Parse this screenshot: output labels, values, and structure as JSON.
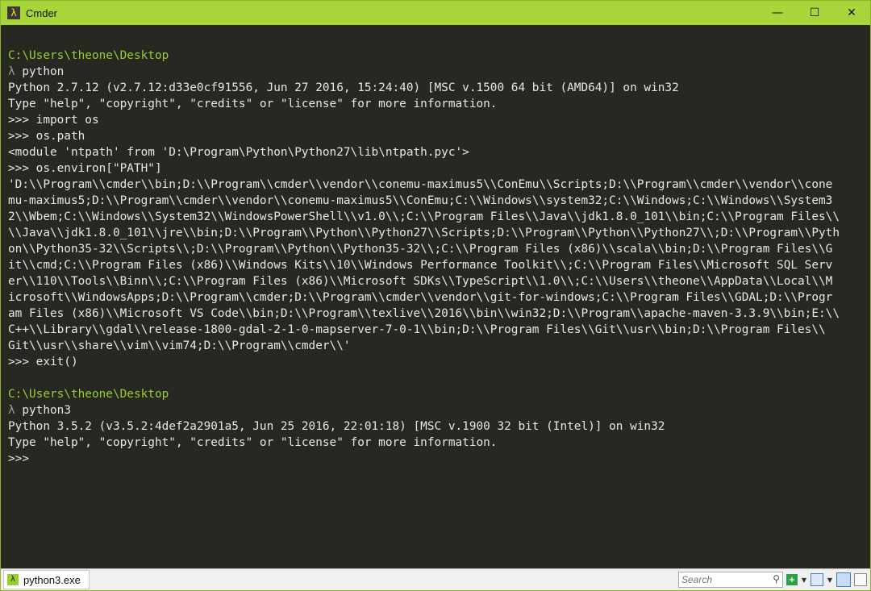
{
  "window": {
    "title": "Cmder",
    "app_icon_glyph": "λ",
    "controls": {
      "minimize": "—",
      "maximize": "☐",
      "close": "✕"
    }
  },
  "terminal": {
    "prompt1_path": "C:\\Users\\theone\\Desktop",
    "prompt1_lambda": "λ",
    "prompt1_cmd": " python",
    "py2_banner": "Python 2.7.12 (v2.7.12:d33e0cf91556, Jun 27 2016, 15:24:40) [MSC v.1500 64 bit (AMD64)] on win32",
    "py2_help": "Type \"help\", \"copyright\", \"credits\" or \"license\" for more information.",
    "cmd_import": ">>> import os",
    "cmd_ospath": ">>> os.path",
    "out_module": "<module 'ntpath' from 'D:\\Program\\Python\\Python27\\lib\\ntpath.pyc'>",
    "cmd_environ": ">>> os.environ[\"PATH\"]",
    "path_lines": [
      "'D:\\\\Program\\\\cmder\\\\bin;D:\\\\Program\\\\cmder\\\\vendor\\\\conemu-maximus5\\\\ConEmu\\\\Scripts;D:\\\\Program\\\\cmder\\\\vendor\\\\cone",
      "mu-maximus5;D:\\\\Program\\\\cmder\\\\vendor\\\\conemu-maximus5\\\\ConEmu;C:\\\\Windows\\\\system32;C:\\\\Windows;C:\\\\Windows\\\\System3",
      "2\\\\Wbem;C:\\\\Windows\\\\System32\\\\WindowsPowerShell\\\\v1.0\\\\;C:\\\\Program Files\\\\Java\\\\jdk1.8.0_101\\\\bin;C:\\\\Program Files\\\\",
      "\\\\Java\\\\jdk1.8.0_101\\\\jre\\\\bin;D:\\\\Program\\\\Python\\\\Python27\\\\Scripts;D:\\\\Program\\\\Python\\\\Python27\\\\;D:\\\\Program\\\\Pyth",
      "on\\\\Python35-32\\\\Scripts\\\\;D:\\\\Program\\\\Python\\\\Python35-32\\\\;C:\\\\Program Files (x86)\\\\scala\\\\bin;D:\\\\Program Files\\\\G",
      "it\\\\cmd;C:\\\\Program Files (x86)\\\\Windows Kits\\\\10\\\\Windows Performance Toolkit\\\\;C:\\\\Program Files\\\\Microsoft SQL Serv",
      "er\\\\110\\\\Tools\\\\Binn\\\\;C:\\\\Program Files (x86)\\\\Microsoft SDKs\\\\TypeScript\\\\1.0\\\\;C:\\\\Users\\\\theone\\\\AppData\\\\Local\\\\M",
      "icrosoft\\\\WindowsApps;D:\\\\Program\\\\cmder;D:\\\\Program\\\\cmder\\\\vendor\\\\git-for-windows;C:\\\\Program Files\\\\GDAL;D:\\\\Progr",
      "am Files (x86)\\\\Microsoft VS Code\\\\bin;D:\\\\Program\\\\texlive\\\\2016\\\\bin\\\\win32;D:\\\\Program\\\\apache-maven-3.3.9\\\\bin;E:\\\\",
      "C++\\\\Library\\\\gdal\\\\release-1800-gdal-2-1-0-mapserver-7-0-1\\\\bin;D:\\\\Program Files\\\\Git\\\\usr\\\\bin;D:\\\\Program Files\\\\",
      "Git\\\\usr\\\\share\\\\vim\\\\vim74;D:\\\\Program\\\\cmder\\\\'"
    ],
    "cmd_exit": ">>> exit()",
    "prompt2_path": "C:\\Users\\theone\\Desktop",
    "prompt2_lambda": "λ",
    "prompt2_cmd": " python3",
    "py3_banner": "Python 3.5.2 (v3.5.2:4def2a2901a5, Jun 25 2016, 22:01:18) [MSC v.1900 32 bit (Intel)] on win32",
    "py3_help": "Type \"help\", \"copyright\", \"credits\" or \"license\" for more information.",
    "py3_prompt": ">>>"
  },
  "statusbar": {
    "tab_label": "python3.exe",
    "tab_icon_glyph": "λ",
    "search_placeholder": "Search",
    "icons": [
      "search-icon",
      "new-console-icon",
      "dropdown-icon",
      "console-panel-icon",
      "split-view-icon",
      "single-view-icon"
    ]
  },
  "colors": {
    "title_bar": "#a8d63a",
    "terminal_bg": "#272822",
    "terminal_fg": "#e8e8e0",
    "path_color": "#9acd32",
    "lambda_color": "#9a9a90"
  }
}
